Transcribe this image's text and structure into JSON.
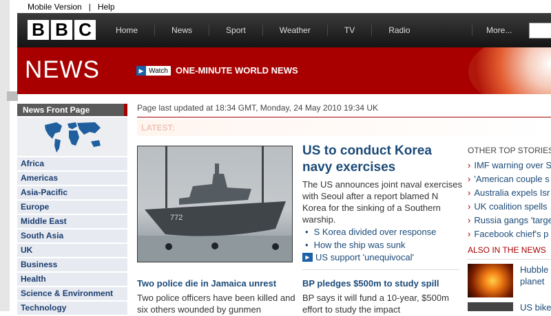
{
  "utility": {
    "mobile": "Mobile Version",
    "sep": "|",
    "help": "Help"
  },
  "logo": {
    "letters": [
      "B",
      "B",
      "C"
    ]
  },
  "nav": {
    "items": [
      "Home",
      "News",
      "Sport",
      "Weather",
      "TV",
      "Radio"
    ],
    "more": "More..."
  },
  "banner": {
    "news": "NEWS",
    "watch": "Watch",
    "title": "ONE-MINUTE WORLD NEWS"
  },
  "sidebar": {
    "front": "News Front Page",
    "items": [
      "Africa",
      "Americas",
      "Asia-Pacific",
      "Europe",
      "Middle East",
      "South Asia",
      "UK",
      "Business",
      "Health",
      "Science & Environment",
      "Technology"
    ]
  },
  "page": {
    "updated": "Page last updated at 18:34 GMT, Monday, 24 May 2010 19:34 UK",
    "latest": "LATEST:"
  },
  "main": {
    "headline": "US to conduct Korea navy exercises",
    "summary": "The US announces joint naval exercises with Seoul after a report blamed N Korea for the sinking of a Southern warship.",
    "related": [
      "S Korea divided over response",
      "How the ship was sunk"
    ],
    "av_link": "US support 'unequivocal'",
    "ship_number": "772"
  },
  "stories": [
    {
      "headline": "Two police die in Jamaica unrest",
      "summary": "Two police officers have been killed and six others wounded by gunmen"
    },
    {
      "headline": "BP pledges $500m to study spill",
      "summary": "BP says it will fund a 10-year, $500m effort to study the impact"
    }
  ],
  "other": {
    "title": "OTHER TOP STORIES",
    "items": [
      "IMF warning over S",
      "'American couple s",
      "Australia expels Isr",
      "UK coalition spells",
      "Russia gangs 'targe",
      "Facebook chief's p"
    ]
  },
  "also": {
    "title": "ALSO IN THE NEWS",
    "items": [
      "Hubble",
      "planet",
      "US bike"
    ]
  },
  "colors": {
    "bbc_red": "#a80000",
    "link_blue": "#1b4a78",
    "masthead": "#1e1e1e"
  }
}
